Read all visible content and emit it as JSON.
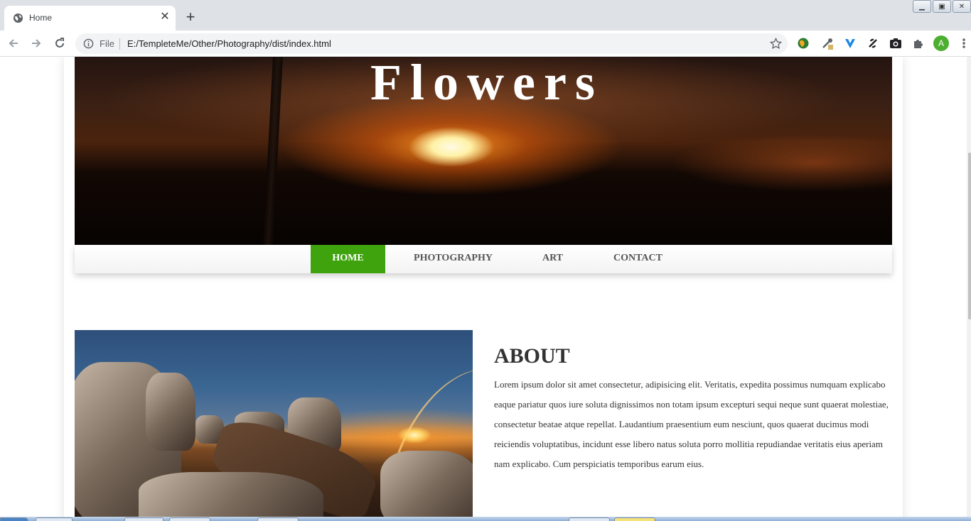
{
  "browser": {
    "tab_title": "Home",
    "omnibox_label": "File",
    "url": "E:/TempleteMe/Other/Photography/dist/index.html",
    "avatar_letter": "A",
    "icons": [
      "back-icon",
      "forward-icon",
      "reload-icon",
      "info-icon",
      "bookmark-star-icon",
      "menu-icon"
    ]
  },
  "page": {
    "hero_title": "Flowers",
    "nav": [
      {
        "label": "HOME",
        "active": true
      },
      {
        "label": "PHOTOGRAPHY",
        "active": false
      },
      {
        "label": "ART",
        "active": false
      },
      {
        "label": "CONTACT",
        "active": false
      }
    ],
    "about": {
      "title": "ABOUT",
      "text": "Lorem ipsum dolor sit amet consectetur, adipisicing elit. Veritatis, expedita possimus numquam explicabo eaque pariatur quos iure soluta dignissimos non totam ipsum excepturi sequi neque sunt quaerat molestiae, consectetur beatae atque repellat. Laudantium praesentium eum nesciunt, quos quaerat ducimus modi reiciendis voluptatibus, incidunt esse libero natus soluta porro mollitia repudiandae veritatis eius aperiam nam explicabo. Cum perspiciatis temporibus earum eius."
    }
  },
  "colors": {
    "nav_active": "#3fa30e",
    "text": "#333333",
    "chrome_tabstrip": "#dee1e6"
  }
}
